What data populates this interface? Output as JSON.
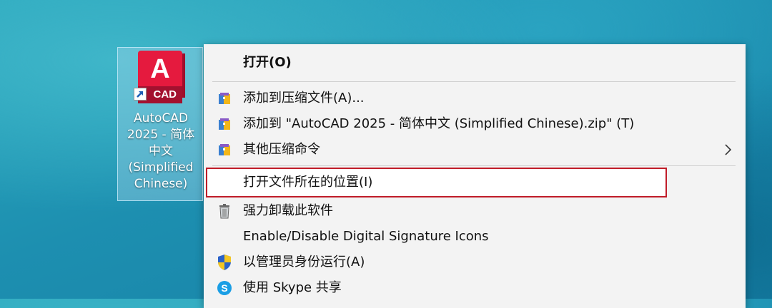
{
  "desktop": {
    "icon": {
      "tile_letter": "A",
      "tile_text": "CAD",
      "label": "AutoCAD\n2025 - 简体\n中文\n(Simplified\nChinese)",
      "accent_color": "#e51a3e"
    }
  },
  "context_menu": {
    "items": [
      {
        "label": "打开(O)",
        "icon": "none",
        "bold": true
      },
      {
        "label": "添加到压缩文件(A)...",
        "icon": "archive-icon"
      },
      {
        "label": "添加到 \"AutoCAD 2025 - 简体中文 (Simplified Chinese).zip\" (T)",
        "icon": "archive-icon"
      },
      {
        "label": "其他压缩命令",
        "icon": "archive-icon",
        "submenu": true
      },
      {
        "label": "打开文件所在的位置(I)",
        "icon": "none",
        "highlighted": true
      },
      {
        "label": "强力卸载此软件",
        "icon": "trash-icon"
      },
      {
        "label": "Enable/Disable Digital Signature Icons",
        "icon": "none"
      },
      {
        "label": "以管理员身份运行(A)",
        "icon": "shield-icon"
      },
      {
        "label": "使用 Skype 共享",
        "icon": "skype-icon"
      }
    ],
    "highlight_color": "#c01c28"
  }
}
